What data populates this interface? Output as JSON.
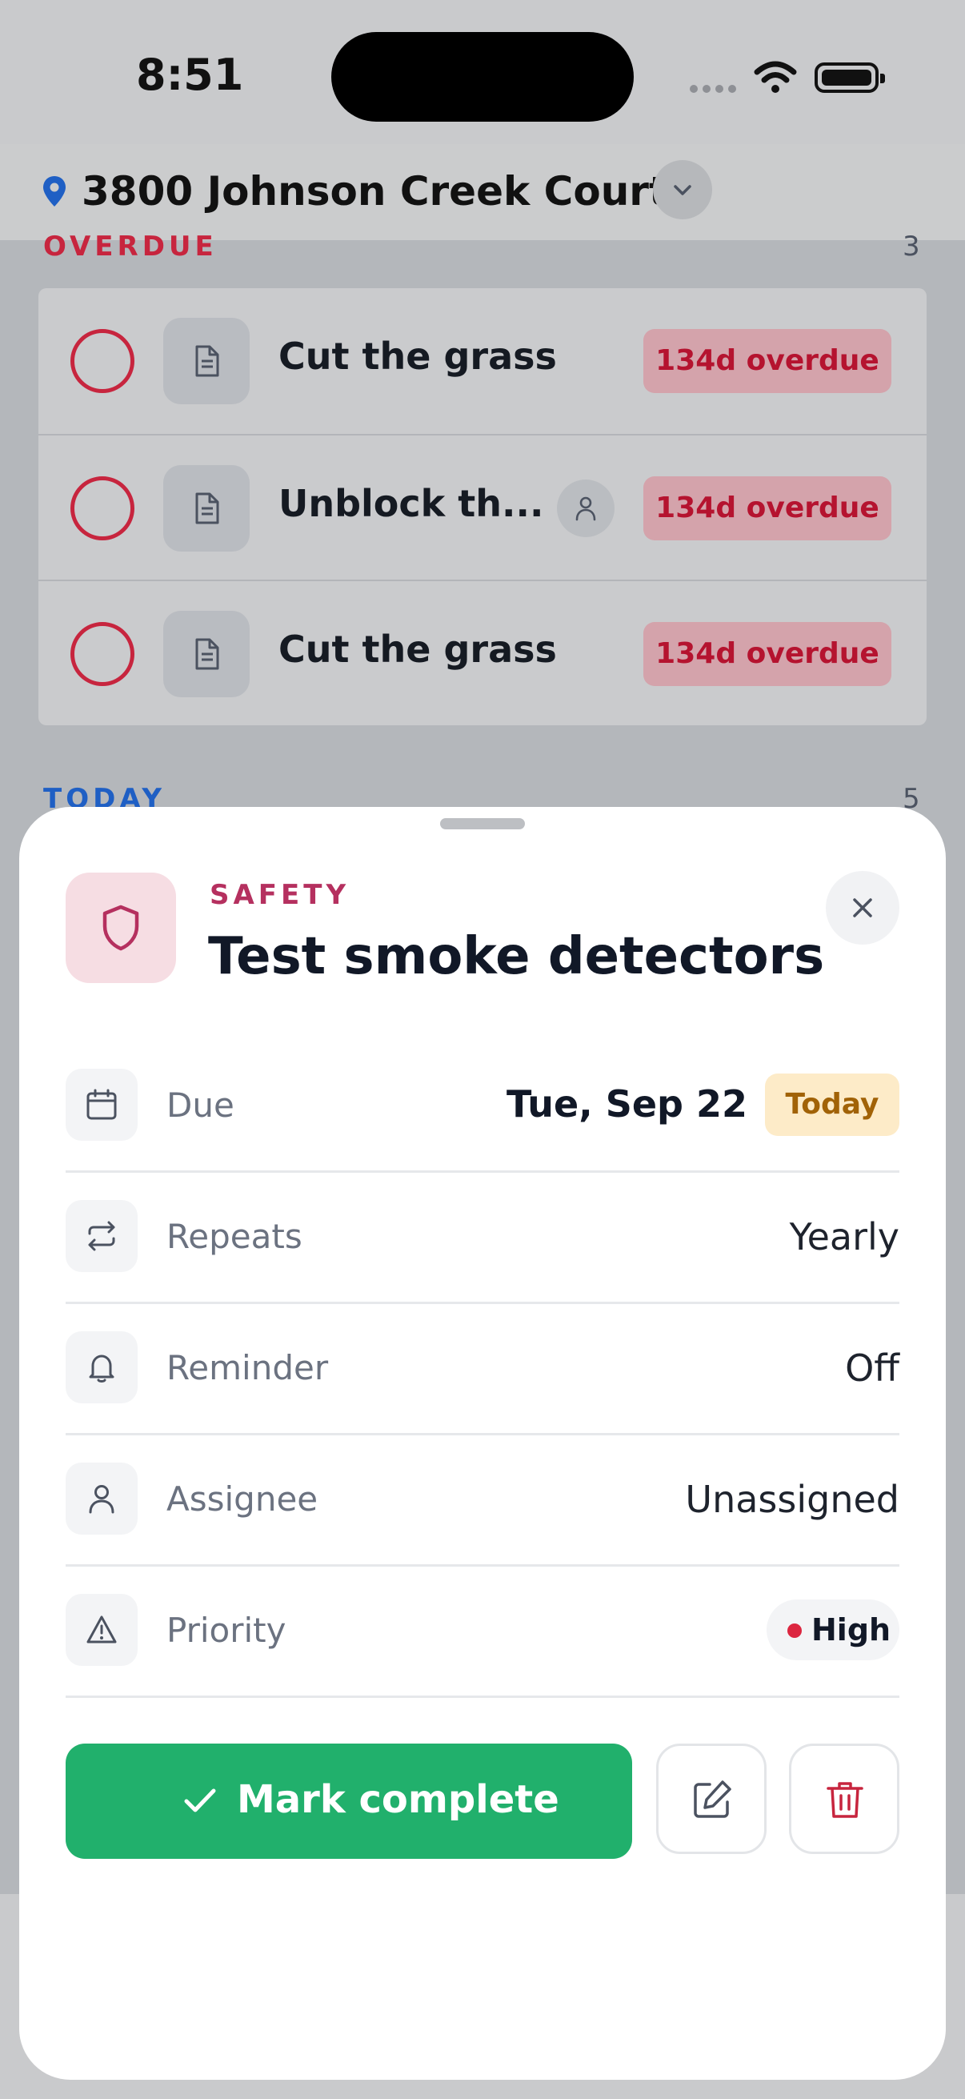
{
  "status_bar": {
    "time": "8:51"
  },
  "header": {
    "address": "3800 Johnson Creek Court"
  },
  "sections": {
    "overdue": {
      "label": "OVERDUE",
      "count": "3"
    },
    "today": {
      "label": "TODAY",
      "count": "5"
    }
  },
  "overdue_tasks": [
    {
      "title": "Cut the grass",
      "badge": "134d overdue"
    },
    {
      "title": "Unblock th...",
      "badge": "134d overdue"
    },
    {
      "title": "Cut the grass",
      "badge": "134d overdue"
    }
  ],
  "sheet": {
    "category": "SAFETY",
    "title": "Test smoke detectors",
    "details": {
      "due": {
        "label": "Due",
        "date": "Tue, Sep 22",
        "badge": "Today"
      },
      "repeats": {
        "label": "Repeats",
        "value": "Yearly"
      },
      "reminder": {
        "label": "Reminder",
        "value": "Off"
      },
      "assignee": {
        "label": "Assignee",
        "value": "Unassigned"
      },
      "priority": {
        "label": "Priority",
        "value": "High"
      }
    },
    "mark_complete_label": "Mark complete"
  },
  "colors": {
    "overdue_red": "#c7253e",
    "today_blue": "#1f5fc4",
    "safety_pink": "#b5305f",
    "complete_green": "#21b06c",
    "today_badge_bg": "#fdebc8",
    "priority_high": "#dc2640"
  },
  "icons": [
    "location-pin-icon",
    "chevron-down-icon",
    "document-icon",
    "person-icon",
    "shield-icon",
    "close-icon",
    "calendar-icon",
    "repeat-icon",
    "bell-icon",
    "warning-icon",
    "checkmark-icon",
    "edit-icon",
    "trash-icon"
  ]
}
